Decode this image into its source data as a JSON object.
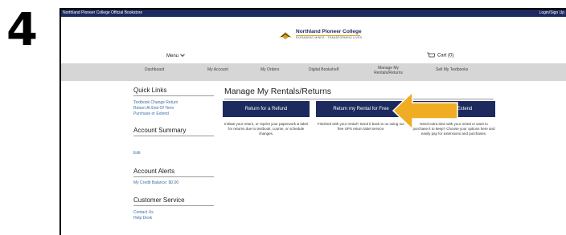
{
  "step": {
    "number": "4"
  },
  "topbar": {
    "store_label": "Northland Pioneer College Official Bookstore",
    "login_label": "Login/Sign Up"
  },
  "logo": {
    "name": "Northland Pioneer College",
    "tagline": "EXPANDING MINDS · TRANSFORMING LIVES"
  },
  "header": {
    "menu_label": "Menu",
    "cart_label": "Cart (0)"
  },
  "nav": {
    "items": [
      {
        "label": "Dashboard"
      },
      {
        "label": "My Account"
      },
      {
        "label": "My Orders"
      },
      {
        "label": "Digital Bookshelf"
      },
      {
        "label": "Manage My Rentals/Returns"
      },
      {
        "label": "Sell My Textbooks"
      }
    ]
  },
  "sidebar": {
    "quick_links_heading": "Quick Links",
    "quick_links": [
      {
        "label": "Textbook Change Return"
      },
      {
        "label": "Return At End Of Term"
      },
      {
        "label": "Purchase or Extend"
      }
    ],
    "account_summary_heading": "Account Summary",
    "edit_label": "Edit",
    "account_alerts_heading": "Account Alerts",
    "credit_balance": "My Credit Balance: $0.00",
    "customer_service_heading": "Customer Service",
    "contact_label": "Contact Us",
    "help_label": "Help Desk"
  },
  "main": {
    "title": "Manage My Rentals/Returns",
    "actions": [
      {
        "label": "Return for a Refund",
        "description": "Initiate your return, or reprint your paperwork & label for returns due to textbook, course, or schedule changes."
      },
      {
        "label": "Return my Rental for Free",
        "description": "Finished with your rental? Send it back to us using our free UPS return label service."
      },
      {
        "label": "r Extend",
        "description": "Need extra time with your rental or want to purchase it to keep? Choose your options here and easily pay for extensions and purchases."
      }
    ]
  },
  "colors": {
    "navy": "#1c2a5e",
    "arrow": "#f0ad23",
    "nav_gray": "#d6d6d6",
    "link_blue": "#3a6ea5"
  }
}
